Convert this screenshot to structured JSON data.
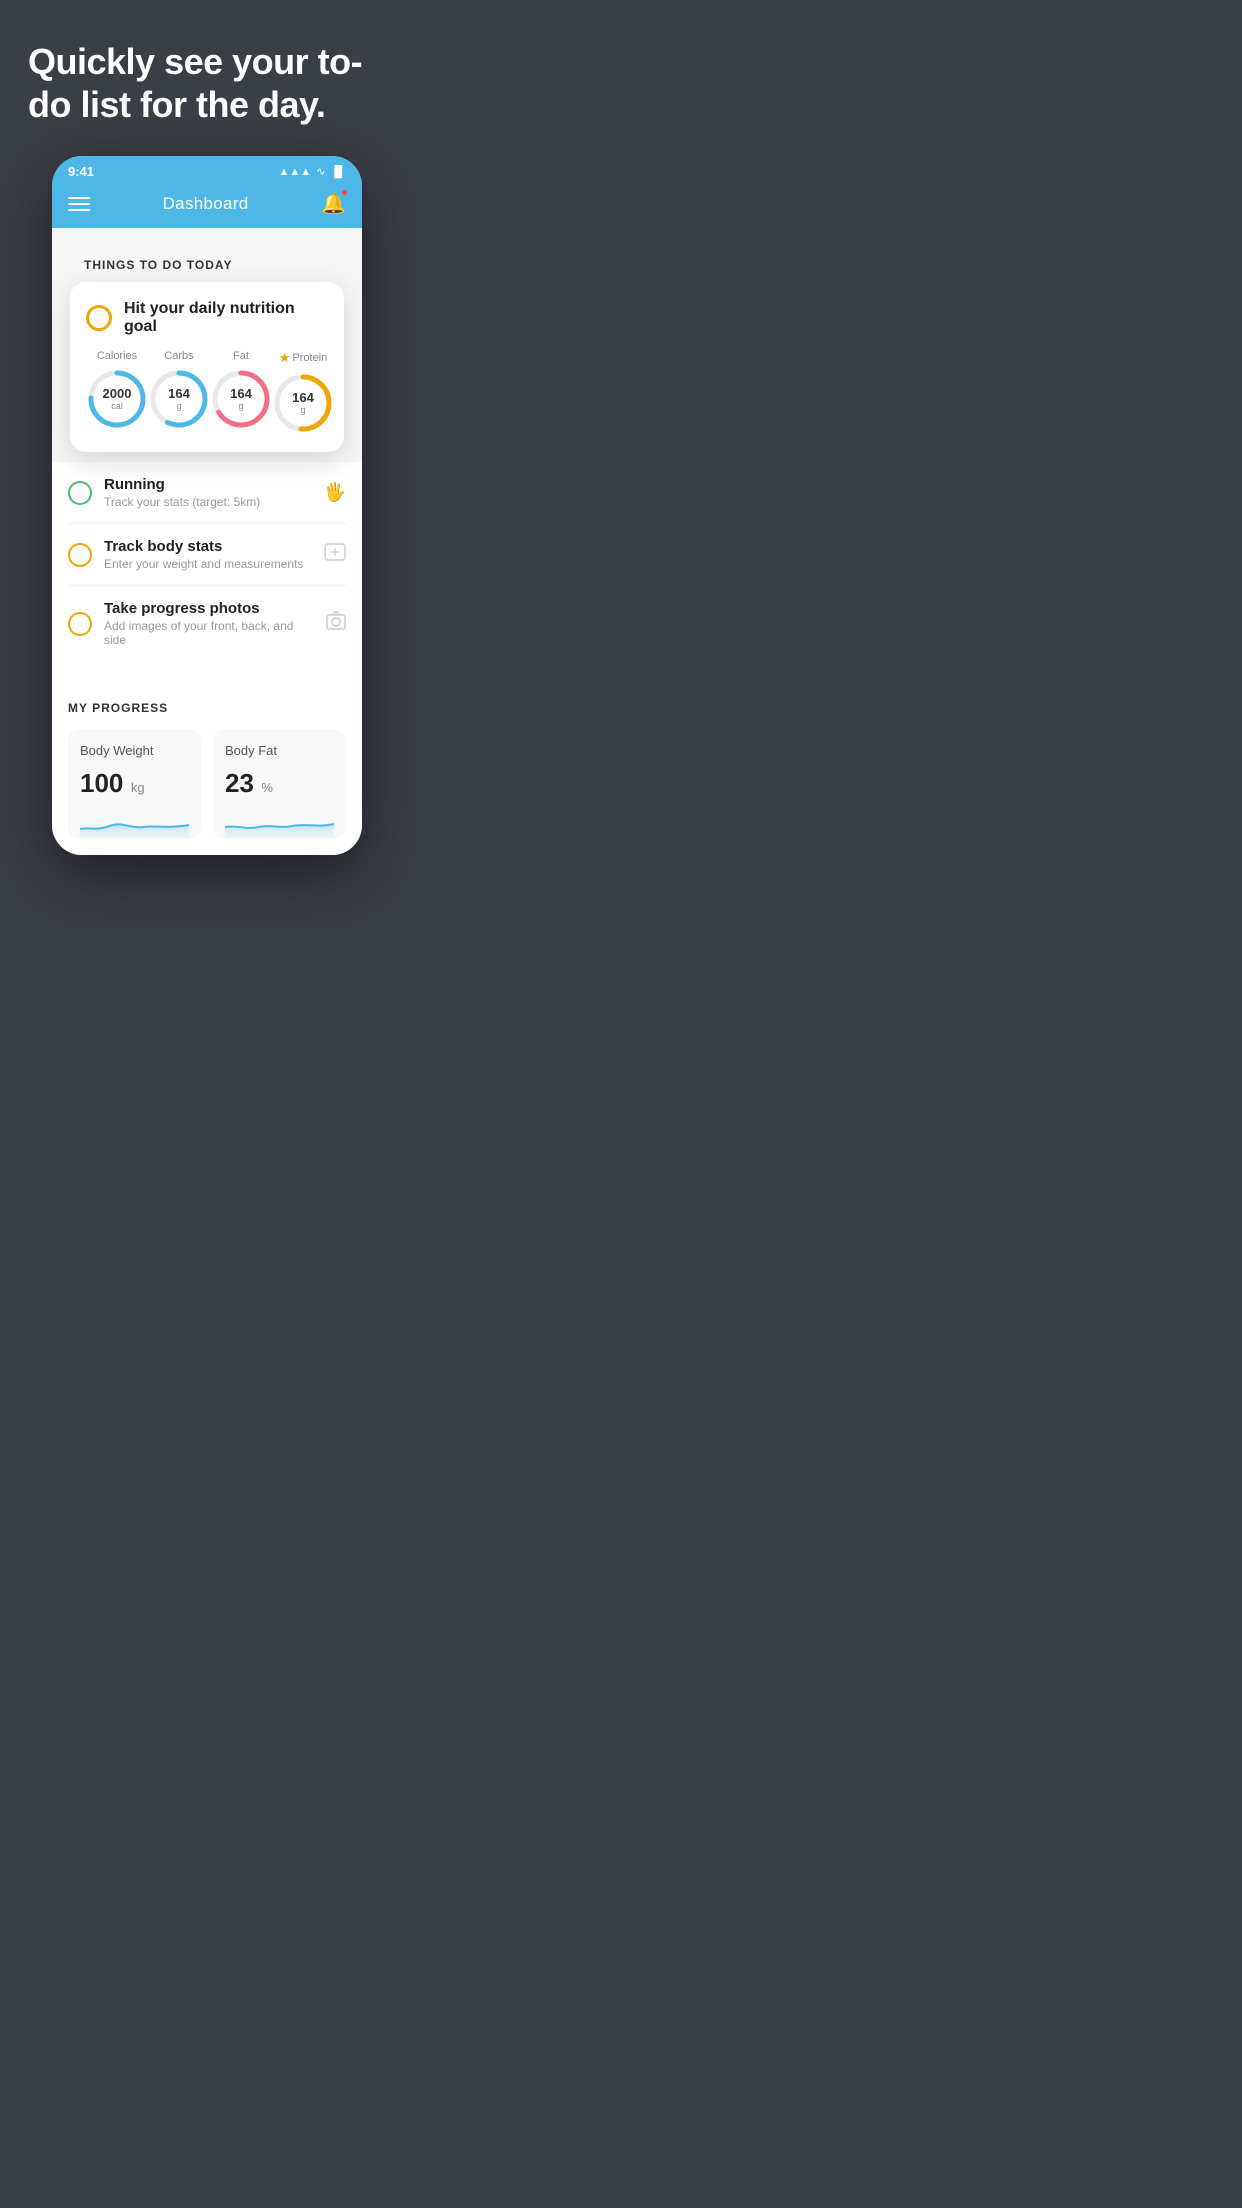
{
  "hero": {
    "title": "Quickly see your to-do list for the day."
  },
  "phone": {
    "statusBar": {
      "time": "9:41",
      "signalIcon": "▲▲▲▲",
      "wifiIcon": "wifi",
      "batteryIcon": "battery"
    },
    "navbar": {
      "title": "Dashboard",
      "menuIcon": "hamburger",
      "notificationIcon": "bell"
    },
    "thingsSection": {
      "header": "THINGS TO DO TODAY"
    },
    "nutritionCard": {
      "radioColor": "#f0a500",
      "title": "Hit your daily nutrition goal",
      "items": [
        {
          "label": "Calories",
          "value": "2000",
          "unit": "cal",
          "color": "#4db8e8",
          "stroke": 75
        },
        {
          "label": "Carbs",
          "value": "164",
          "unit": "g",
          "color": "#4db8e8",
          "stroke": 55
        },
        {
          "label": "Fat",
          "value": "164",
          "unit": "g",
          "color": "#f46f83",
          "stroke": 65
        },
        {
          "label": "Protein",
          "value": "164",
          "unit": "g",
          "color": "#f0a500",
          "stroke": 50,
          "starred": true
        }
      ]
    },
    "todoItems": [
      {
        "type": "green",
        "title": "Running",
        "subtitle": "Track your stats (target: 5km)",
        "icon": "shoe"
      },
      {
        "type": "yellow",
        "title": "Track body stats",
        "subtitle": "Enter your weight and measurements",
        "icon": "scale"
      },
      {
        "type": "yellow",
        "title": "Take progress photos",
        "subtitle": "Add images of your front, back, and side",
        "icon": "photo"
      }
    ],
    "progressSection": {
      "header": "MY PROGRESS",
      "cards": [
        {
          "title": "Body Weight",
          "value": "100",
          "unit": "kg"
        },
        {
          "title": "Body Fat",
          "value": "23",
          "unit": "%"
        }
      ]
    }
  }
}
